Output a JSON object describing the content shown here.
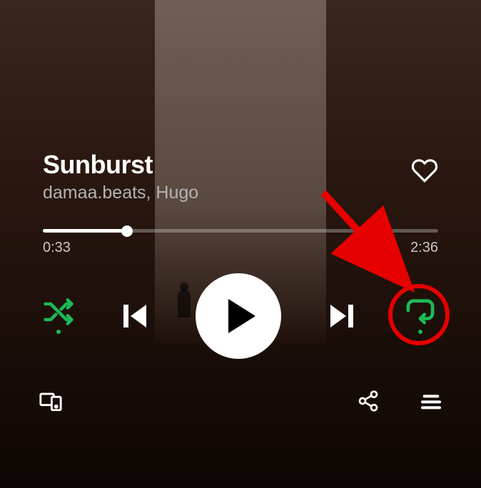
{
  "track": {
    "title": "Sunburst",
    "artist": "damaa.beats, Hugo"
  },
  "playback": {
    "elapsed": "0:33",
    "duration": "2:36",
    "progress_percent": 21.3,
    "is_playing": false
  },
  "controls": {
    "shuffle_active": true,
    "repeat_mode": "context",
    "liked": false
  },
  "colors": {
    "accent": "#1db954",
    "annotation": "#e60000"
  },
  "annotation": {
    "target": "repeat-button",
    "type": "arrow-circle-highlight"
  }
}
